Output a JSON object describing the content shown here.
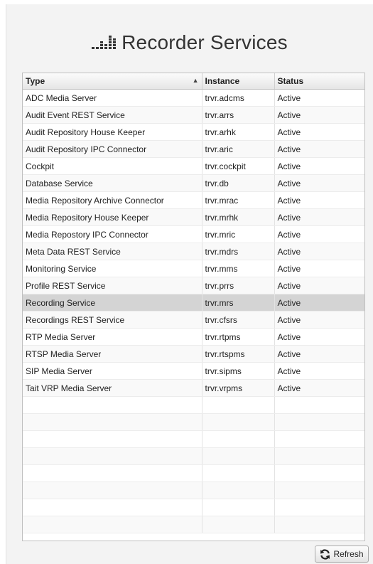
{
  "header": {
    "title": "Recorder Services",
    "logo_icon": "equalizer-bars-icon"
  },
  "table": {
    "columns": [
      {
        "label": "Type",
        "sort": "ascending"
      },
      {
        "label": "Instance"
      },
      {
        "label": "Status"
      }
    ],
    "rows": [
      {
        "type": "ADC Media Server",
        "instance": "trvr.adcms",
        "status": "Active"
      },
      {
        "type": "Audit Event REST Service",
        "instance": "trvr.arrs",
        "status": "Active"
      },
      {
        "type": "Audit Repository House Keeper",
        "instance": "trvr.arhk",
        "status": "Active"
      },
      {
        "type": "Audit Repository IPC Connector",
        "instance": "trvr.aric",
        "status": "Active"
      },
      {
        "type": "Cockpit",
        "instance": "trvr.cockpit",
        "status": "Active"
      },
      {
        "type": "Database Service",
        "instance": "trvr.db",
        "status": "Active"
      },
      {
        "type": "Media Repository Archive Connector",
        "instance": "trvr.mrac",
        "status": "Active"
      },
      {
        "type": "Media Repository House Keeper",
        "instance": "trvr.mrhk",
        "status": "Active"
      },
      {
        "type": "Media Repostory IPC Connector",
        "instance": "trvr.mric",
        "status": "Active"
      },
      {
        "type": "Meta Data REST Service",
        "instance": "trvr.mdrs",
        "status": "Active"
      },
      {
        "type": "Monitoring Service",
        "instance": "trvr.mms",
        "status": "Active"
      },
      {
        "type": "Profile REST Service",
        "instance": "trvr.prrs",
        "status": "Active"
      },
      {
        "type": "Recording Service",
        "instance": "trvr.mrs",
        "status": "Active",
        "selected": true
      },
      {
        "type": "Recordings REST Service",
        "instance": "trvr.cfsrs",
        "status": "Active"
      },
      {
        "type": "RTP Media Server",
        "instance": "trvr.rtpms",
        "status": "Active"
      },
      {
        "type": "RTSP Media Server",
        "instance": "trvr.rtspms",
        "status": "Active"
      },
      {
        "type": "SIP Media Server",
        "instance": "trvr.sipms",
        "status": "Active"
      },
      {
        "type": "Tait VRP Media Server",
        "instance": "trvr.vrpms",
        "status": "Active"
      }
    ]
  },
  "refresh_button": {
    "label": "Refresh",
    "icon": "refresh-icon"
  },
  "colors": {
    "selected_row": "#d4d4d4",
    "panel_bg": "#f3f3f3",
    "title": "#333333"
  }
}
